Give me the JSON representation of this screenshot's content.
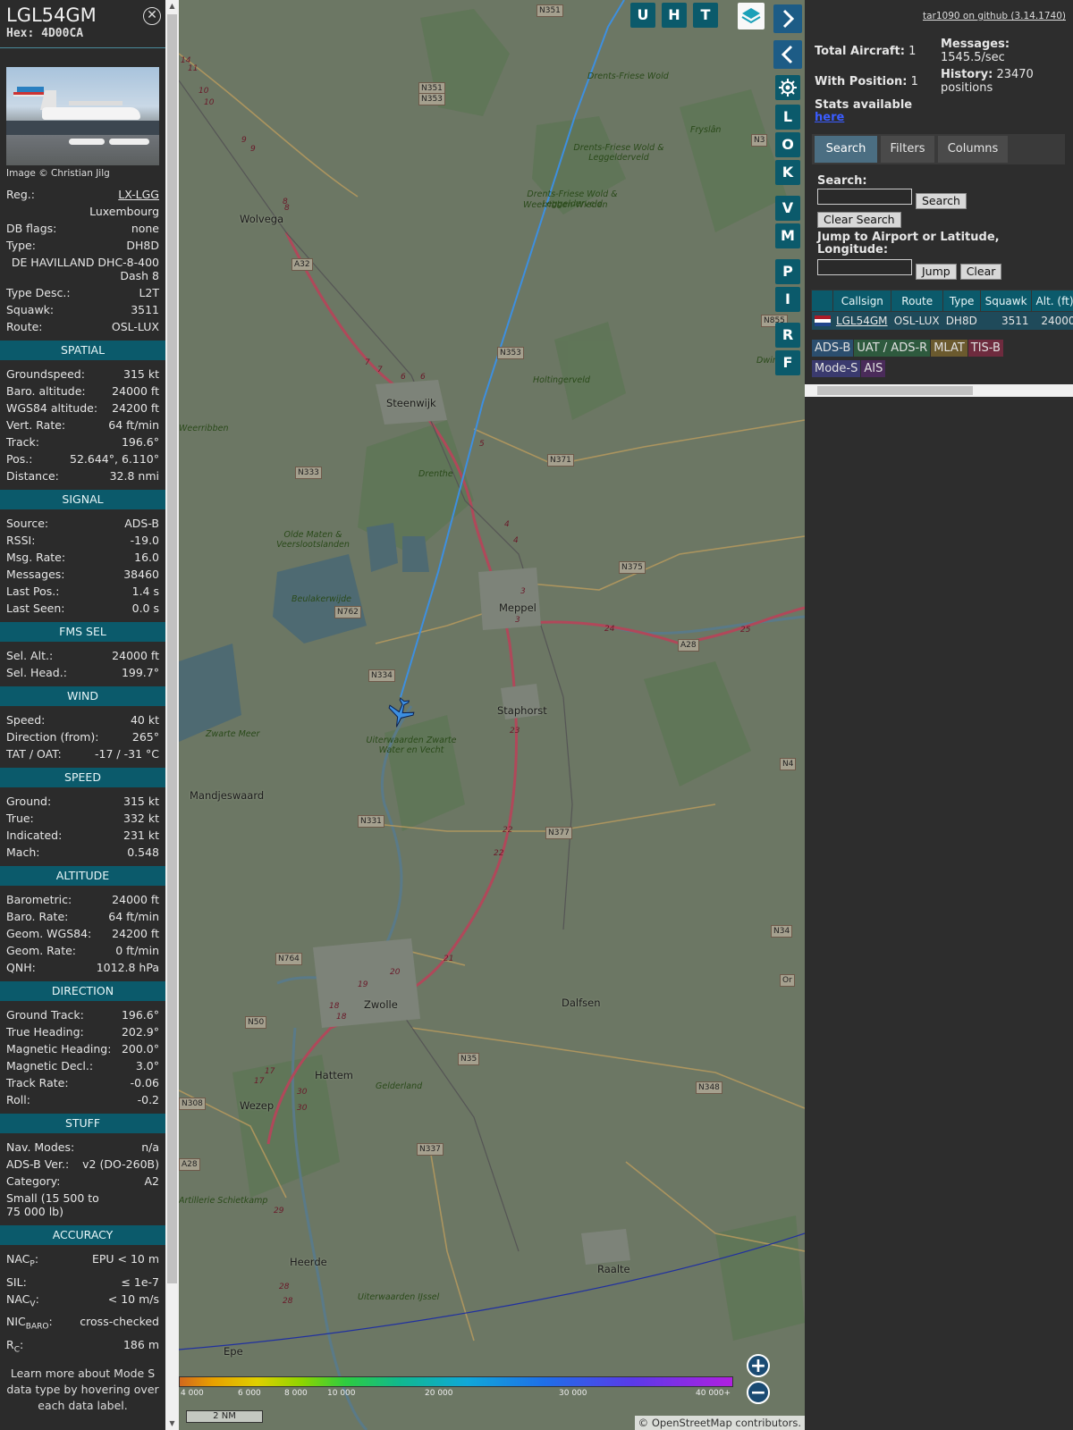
{
  "aircraft": {
    "callsign": "LGL54GM",
    "hex": "Hex: 4D00CA",
    "photo_credit": "Image © Christian Jilg",
    "reg_label": "Reg.:",
    "reg": "LX-LGG",
    "country": "Luxembourg",
    "dbflags_label": "DB flags:",
    "dbflags": "none",
    "type_label": "Type:",
    "type": "DH8D",
    "type_full": "DE HAVILLAND DHC-8-400 Dash 8",
    "typedesc_label": "Type Desc.:",
    "typedesc": "L2T",
    "squawk_label": "Squawk:",
    "squawk": "3511",
    "route_label": "Route:",
    "route": "OSL-LUX"
  },
  "sections": {
    "spatial": "SPATIAL",
    "signal": "SIGNAL",
    "fmssel": "FMS SEL",
    "wind": "WIND",
    "speed": "SPEED",
    "altitude": "ALTITUDE",
    "direction": "DIRECTION",
    "stuff": "STUFF",
    "accuracy": "ACCURACY"
  },
  "spatial": [
    {
      "k": "Groundspeed:",
      "v": "315 kt"
    },
    {
      "k": "Baro. altitude:",
      "v": "24000 ft"
    },
    {
      "k": "WGS84 altitude:",
      "v": "24200 ft"
    },
    {
      "k": "Vert. Rate:",
      "v": "64 ft/min"
    },
    {
      "k": "Track:",
      "v": "196.6°"
    },
    {
      "k": "Pos.:",
      "v": "52.644°, 6.110°"
    },
    {
      "k": "Distance:",
      "v": "32.8 nmi"
    }
  ],
  "signal": [
    {
      "k": "Source:",
      "v": "ADS-B"
    },
    {
      "k": "RSSI:",
      "v": "-19.0"
    },
    {
      "k": "Msg. Rate:",
      "v": "16.0"
    },
    {
      "k": "Messages:",
      "v": "38460"
    },
    {
      "k": "Last Pos.:",
      "v": "1.4 s"
    },
    {
      "k": "Last Seen:",
      "v": "0.0 s"
    }
  ],
  "fmssel": [
    {
      "k": "Sel. Alt.:",
      "v": "24000 ft"
    },
    {
      "k": "Sel. Head.:",
      "v": "199.7°"
    }
  ],
  "wind": [
    {
      "k": "Speed:",
      "v": "40 kt"
    },
    {
      "k": "Direction (from):",
      "v": "265°"
    },
    {
      "k": "TAT / OAT:",
      "v": "-17 / -31 °C"
    }
  ],
  "speed": [
    {
      "k": "Ground:",
      "v": "315 kt"
    },
    {
      "k": "True:",
      "v": "332 kt"
    },
    {
      "k": "Indicated:",
      "v": "231 kt"
    },
    {
      "k": "Mach:",
      "v": "0.548"
    }
  ],
  "altitude": [
    {
      "k": "Barometric:",
      "v": "24000 ft"
    },
    {
      "k": "Baro. Rate:",
      "v": "64 ft/min"
    },
    {
      "k": "Geom. WGS84:",
      "v": "24200 ft"
    },
    {
      "k": "Geom. Rate:",
      "v": "0 ft/min"
    },
    {
      "k": "QNH:",
      "v": "1012.8 hPa"
    }
  ],
  "direction": [
    {
      "k": "Ground Track:",
      "v": "196.6°"
    },
    {
      "k": "True Heading:",
      "v": "202.9°"
    },
    {
      "k": "Magnetic Heading:",
      "v": "200.0°"
    },
    {
      "k": "Magnetic Decl.:",
      "v": "3.0°"
    },
    {
      "k": "Track Rate:",
      "v": "-0.06"
    },
    {
      "k": "Roll:",
      "v": "-0.2"
    }
  ],
  "stuff": {
    "navmodes_label": "Nav. Modes:",
    "navmodes": "n/a",
    "adsbver_label": "ADS-B Ver.:",
    "adsbver": "v2 (DO-260B)",
    "category_label": "Category:",
    "category": "A2",
    "category_desc": "Small (15 500 to 75 000 lb)"
  },
  "accuracy": {
    "nacp_label": "NAC",
    "nacp_sub": "P",
    "nacp": "EPU < 10 m",
    "sil_label": "SIL:",
    "sil": "≤ 1e-7",
    "nacv_label": "NAC",
    "nacv_sub": "V",
    "nacv": "< 10 m/s",
    "nicbaro_label": "NIC",
    "nicbaro_sub": "BARO",
    "nicbaro": "cross-checked",
    "rc_label": "R",
    "rc_sub": "C",
    "rc": "186 m"
  },
  "learn_more": "Learn more about Mode S data type by hovering over each data label.",
  "map": {
    "buttons_top": [
      "U",
      "H",
      "T"
    ],
    "buttons_side": [
      "L",
      "O",
      "K",
      "V",
      "M",
      "P",
      "I",
      "R",
      "F"
    ],
    "scale": "2 NM",
    "attribution": "© OpenStreetMap contributors.",
    "alt_ticks": [
      "4 000",
      "6 000",
      "8 000",
      "10 000",
      "20 000",
      "30 000",
      "40 000+"
    ],
    "places": [
      {
        "name": "Wolvega"
      },
      {
        "name": "Steenwijk"
      },
      {
        "name": "Meppel"
      },
      {
        "name": "Staphorst"
      },
      {
        "name": "Zwolle"
      },
      {
        "name": "Dalfsen"
      },
      {
        "name": "Hattem"
      },
      {
        "name": "Wezep"
      },
      {
        "name": "Heerde"
      },
      {
        "name": "Raalte"
      },
      {
        "name": "Epe"
      },
      {
        "name": "Mandjeswaard"
      }
    ],
    "greens": [
      "Drents-Friese Wold",
      "Drents-Friese Wold & Leggelderveld",
      "Drents-Friese Wold & Leggelderveld",
      "Weerribben-Wieden",
      "Olde Maten & Veerslootslanden",
      "Uiterwaarden Zwarte Water en Vecht",
      "Zwarte Meer",
      "Artillerie Schietkamp",
      "Uiterwaarden IJssel",
      "Holtingerveld",
      "Beulakerwijde",
      "Weerribben",
      "Dwing",
      "Fryslân",
      "Drenthe",
      "Gelderland"
    ],
    "roads": [
      "N351",
      "N351",
      "N353",
      "N353",
      "A32",
      "N333",
      "N371",
      "N375",
      "N762",
      "N334",
      "A28",
      "N331",
      "N377",
      "N764",
      "N50",
      "N35",
      "N348",
      "N308",
      "A28",
      "N337",
      "N855",
      "N3",
      "N34",
      "N4",
      "Or"
    ],
    "exits": [
      "10",
      "10",
      "9",
      "9",
      "8",
      "8",
      "7",
      "7",
      "6",
      "6",
      "5",
      "4",
      "4",
      "3",
      "3",
      "24",
      "25",
      "23",
      "22",
      "22",
      "21",
      "20",
      "19",
      "18",
      "18",
      "17",
      "17",
      "30",
      "30",
      "29",
      "28",
      "28",
      "14",
      "11"
    ]
  },
  "right": {
    "github": "tar1090 on github (3.14.1740)",
    "total_label": "Total Aircraft:",
    "total": "1",
    "withpos_label": "With Position:",
    "withpos": "1",
    "stats_label": "Stats available",
    "stats_link": "here",
    "messages_label": "Messages:",
    "messages": "1545.5/sec",
    "history_label": "History:",
    "history": "23470 positions",
    "tabs": [
      "Search",
      "Filters",
      "Columns"
    ],
    "search_label": "Search:",
    "search_button": "Search",
    "clear_search": "Clear Search",
    "jump_label": "Jump to Airport or Latitude, Longitude:",
    "jump_button": "Jump",
    "clear_button": "Clear",
    "table_headers": [
      "Callsign",
      "Route",
      "Type",
      "Squawk",
      "Alt. (ft)"
    ],
    "table_row": {
      "callsign": "LGL54GM",
      "route": "OSL-LUX",
      "type": "DH8D",
      "squawk": "3511",
      "alt": "24000"
    },
    "badges": [
      {
        "label": "ADS-B",
        "color": "#2b4e6e"
      },
      {
        "label": "UAT / ADS-R",
        "color": "#2e5a3e"
      },
      {
        "label": "MLAT",
        "color": "#6b5a2e"
      },
      {
        "label": "TIS-B",
        "color": "#6e2b3e"
      },
      {
        "label": "Mode-S",
        "color": "#3a3a6e"
      },
      {
        "label": "AIS",
        "color": "#4a2b5a"
      }
    ]
  }
}
